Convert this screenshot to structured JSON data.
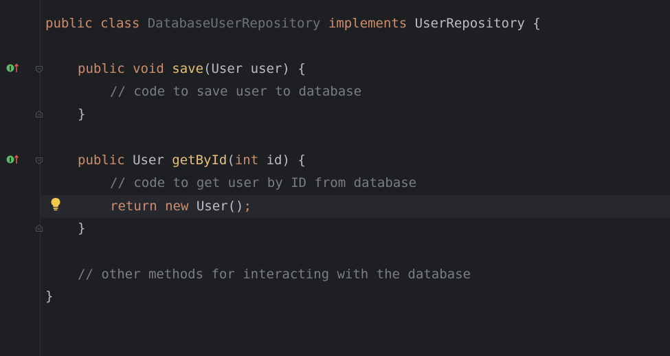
{
  "editor": {
    "lines": [
      {
        "tokens": [
          {
            "t": "public class ",
            "c": "kw"
          },
          {
            "t": "DatabaseUserRepository",
            "c": "cls-decl"
          },
          {
            "t": " implements ",
            "c": "kw"
          },
          {
            "t": "UserRepository",
            "c": "type"
          },
          {
            "t": " {",
            "c": "punct"
          }
        ]
      },
      {
        "tokens": [
          {
            "t": "public void ",
            "c": "kw"
          },
          {
            "t": "save",
            "c": "method-name"
          },
          {
            "t": "(User user) {",
            "c": "punct"
          }
        ]
      },
      {
        "tokens": [
          {
            "t": "// code to save user to database",
            "c": "comment"
          }
        ]
      },
      {
        "tokens": [
          {
            "t": "}",
            "c": "punct"
          }
        ]
      },
      {
        "tokens": [
          {
            "t": "public ",
            "c": "kw"
          },
          {
            "t": "User ",
            "c": "type"
          },
          {
            "t": "getById",
            "c": "method-name"
          },
          {
            "t": "(",
            "c": "punct"
          },
          {
            "t": "int",
            "c": "kw"
          },
          {
            "t": " id) {",
            "c": "punct"
          }
        ]
      },
      {
        "tokens": [
          {
            "t": "// code to get user by ID from database",
            "c": "comment"
          }
        ]
      },
      {
        "tokens": [
          {
            "t": "return new ",
            "c": "kw"
          },
          {
            "t": "User()",
            "c": "type"
          },
          {
            "t": ";",
            "c": "semi"
          }
        ]
      },
      {
        "tokens": [
          {
            "t": "}",
            "c": "punct"
          }
        ]
      },
      {
        "tokens": [
          {
            "t": "// other methods for interacting with the database",
            "c": "comment"
          }
        ]
      },
      {
        "tokens": [
          {
            "t": "}",
            "c": "punct"
          }
        ]
      }
    ]
  },
  "gutter": {
    "implements_icon": "implements-method-icon",
    "fold_icon": "fold-marker-icon",
    "intention_icon": "lightbulb-icon",
    "colors": {
      "implements_green": "#5fb865",
      "implements_arrow": "#e5554f",
      "bulb": "#f2c94c"
    }
  },
  "colors": {
    "background": "#1e1f22",
    "caret_line": "#26282e",
    "keyword": "#cf8e6d",
    "method": "#e6c17a",
    "comment": "#7a7e85",
    "text": "#bcbec4"
  }
}
